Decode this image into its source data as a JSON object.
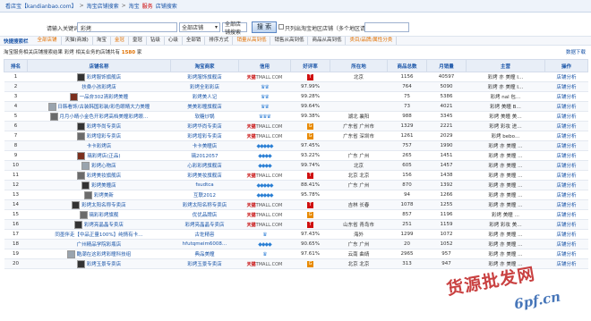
{
  "topbar": {
    "site": "看店宝【kandianbao.com】",
    "crumb1": "淘宝店铺搜索",
    "crumb2_a": "淘宝",
    "crumb2_b": "服务",
    "crumb2_c": "店铺搜索"
  },
  "search": {
    "label": "请输入关键词",
    "keyword": "彩烤",
    "select1": "全部店铺",
    "select2": "全部店铺搜索",
    "button": "搜 索",
    "checkbox_label": "只列出淘宝地区店铺（多个地区请用,区分）"
  },
  "filters": {
    "title": "快捷搜索栏",
    "items": [
      "全部店铺",
      "天猫(商城)",
      "淘宝",
      "金冠",
      "皇冠",
      "钻级",
      "心级",
      "全部销",
      "排序方式",
      "销量从高到低",
      "销售从高到低",
      "商品从高到低",
      "类目/品牌/属性分类"
    ]
  },
  "info": {
    "prefix": "淘宝服务相关店铺搜索结果 彩烤 相关业务的店铺共有",
    "count": "1580",
    "suffix": "家",
    "right": "数据下载"
  },
  "columns": [
    "排名",
    "店铺名称",
    "淘宝商家",
    "信用",
    "好评率",
    "所在地",
    "商品总数",
    "月销量",
    "主营",
    "操作"
  ],
  "rows": [
    {
      "rank": "1",
      "thumb": "t3",
      "shop": "彩烤服饰旗舰店",
      "seller": "彩烤服饰旗舰店",
      "credit": "tmall",
      "rate": "T",
      "loc": "北京",
      "goods": "1156",
      "sales": "40597",
      "main": "彩烤 亦 美瞳 I…",
      "act": "店铺分析"
    },
    {
      "rank": "2",
      "thumb": "",
      "shop": "扶桑小孩彩烤店",
      "seller": "彩烤全彩彩店",
      "credit": "crown2",
      "rate": "97.99%",
      "loc": "",
      "goods": "764",
      "sales": "5090",
      "main": "彩烤 亦 美瞳 I…",
      "act": "店铺分析"
    },
    {
      "rank": "3",
      "thumb": "t0",
      "shop": "一品夯302清彩烤美瞳",
      "seller": "彩烤美人记",
      "credit": "crown2",
      "rate": "99.28%",
      "loc": "",
      "goods": "75",
      "sales": "5386",
      "main": "彩烤 nal 包…",
      "act": "店铺分析"
    },
    {
      "rank": "4",
      "thumb": "t1",
      "shop": "日韩看饰/古装韩国彩装/彩色眼睛大力美瞳",
      "seller": "美美彩瞳旗舰店",
      "credit": "crown2",
      "rate": "99.64%",
      "loc": "",
      "goods": "73",
      "sales": "4021",
      "main": "彩烤 美瞳 B…",
      "act": "店铺分析"
    },
    {
      "rank": "5",
      "thumb": "t2",
      "shop": "月月小睛小金色开彩烤高档美瞳彩烤眼…",
      "seller": "软糖炒锅",
      "credit": "crown3",
      "rate": "99.38%",
      "loc": "湖北 襄阳",
      "goods": "988",
      "sales": "3345",
      "main": "彩烤 美瞳 美…",
      "act": "店铺分析"
    },
    {
      "rank": "6",
      "thumb": "t3",
      "shop": "彩烤华尚专卖店",
      "seller": "彩烤华尚专卖店",
      "credit": "tmall",
      "rate": "G",
      "loc": "广东省 广州市",
      "goods": "1329",
      "sales": "2221",
      "main": "彩烤 彩妆 进…",
      "act": "店铺分析"
    },
    {
      "rank": "7",
      "thumb": "t2",
      "shop": "彩烤增彩专卖店",
      "seller": "彩烤增彩专卖店",
      "credit": "tmall",
      "rate": "G",
      "loc": "广东省 深圳市",
      "goods": "1261",
      "sales": "2029",
      "main": "彩烤 bebo…",
      "act": "店铺分析"
    },
    {
      "rank": "8",
      "thumb": "",
      "shop": "卡卡彩烤店",
      "seller": "卡卡美瞳店",
      "credit": "diamond5",
      "rate": "97.45%",
      "loc": "",
      "goods": "757",
      "sales": "1990",
      "main": "彩烤 亦 美瞳 …",
      "act": "店铺分析"
    },
    {
      "rank": "9",
      "thumb": "t0",
      "shop": "璃彩烤店(正品)",
      "seller": "璃2012057",
      "credit": "diamond4",
      "rate": "93.22%",
      "loc": "广东 广州",
      "goods": "265",
      "sales": "1451",
      "main": "彩烤 亦 美瞳 …",
      "act": "店铺分析"
    },
    {
      "rank": "10",
      "thumb": "t1",
      "shop": "彩烤心物店",
      "seller": "心彩彩烤旗舰店",
      "credit": "diamond4",
      "rate": "99.74%",
      "loc": "北京",
      "goods": "605",
      "sales": "1457",
      "main": "彩烤 亦 美瞳 …",
      "act": "店铺分析"
    },
    {
      "rank": "11",
      "thumb": "t2",
      "shop": "彩烤美妆旗舰店",
      "seller": "彩烤美妆旗舰店",
      "credit": "tmall",
      "rate": "T",
      "loc": "北京 北京",
      "goods": "156",
      "sales": "1438",
      "main": "彩烤 亦 美瞳 …",
      "act": "店铺分析"
    },
    {
      "rank": "12",
      "thumb": "t3",
      "shop": "彩烤美瞳店",
      "seller": "fsudtca",
      "credit": "diamond5",
      "rate": "88.41%",
      "loc": "广东 广州",
      "goods": "870",
      "sales": "1392",
      "main": "彩烤 亦 美瞳 …",
      "act": "店铺分析"
    },
    {
      "rank": "13",
      "thumb": "t2",
      "shop": "彩烤美新",
      "seller": "互联2012",
      "credit": "diamond5",
      "rate": "95.78%",
      "loc": "",
      "goods": "94",
      "sales": "1266",
      "main": "彩烤 亦 美瞳 …",
      "act": "店铺分析"
    },
    {
      "rank": "14",
      "thumb": "t3",
      "shop": "彩烤太阳名称专卖店",
      "seller": "彩烤太阳名称专卖店",
      "credit": "tmall",
      "rate": "T",
      "loc": "吉林 长春",
      "goods": "1078",
      "sales": "1255",
      "main": "彩烤 亦 美瞳 …",
      "act": "店铺分析"
    },
    {
      "rank": "15",
      "thumb": "t2",
      "shop": "璃彩彩烤旗舰",
      "seller": "优优品牌店",
      "credit": "tmall",
      "rate": "G",
      "loc": "",
      "goods": "857",
      "sales": "1196",
      "main": "彩烤 美瞳 …",
      "act": "店铺分析"
    },
    {
      "rank": "16",
      "thumb": "t3",
      "shop": "彩烤亮晶晶专卖店",
      "seller": "彩烤亮晶晶专卖店",
      "credit": "tmall",
      "rate": "T",
      "loc": "山东省 青岛市",
      "goods": "251",
      "sales": "1159",
      "main": "彩烤 彩妆 美…",
      "act": "店铺分析"
    },
    {
      "rank": "17",
      "thumb": "",
      "shop": "同墨伴走【中品正量100%】纯情有卡…",
      "seller": "古佐精容",
      "credit": "crown1",
      "rate": "97.43%",
      "loc": "海外",
      "goods": "1299",
      "sales": "1072",
      "main": "彩烤 亦 美瞳 …",
      "act": "店铺分析"
    },
    {
      "rank": "18",
      "thumb": "",
      "shop": "广州精品学院彩瓶店",
      "seller": "hfutqmeim6008…",
      "credit": "diamond4",
      "rate": "90.65%",
      "loc": "广东 广州",
      "goods": "20",
      "sales": "1052",
      "main": "彩烤 亦 美瞳 …",
      "act": "店铺分析"
    },
    {
      "rank": "19",
      "thumb": "t1",
      "shop": "酷潮在这彩烤彩瞳科技组",
      "seller": "典品美瞳",
      "credit": "crown1",
      "rate": "97.61%",
      "loc": "云南 曲靖",
      "goods": "2965",
      "sales": "957",
      "main": "彩烤 亦 美瞳 …",
      "act": "店铺分析"
    },
    {
      "rank": "20",
      "thumb": "t3",
      "shop": "彩烤玉景专卖店",
      "seller": "彩烤玉景专卖店",
      "credit": "tmall",
      "rate": "G",
      "loc": "北京 北京",
      "goods": "313",
      "sales": "947",
      "main": "彩烤 亦 美瞳 …",
      "act": "店铺分析"
    }
  ],
  "watermark": {
    "line1": "货源批发网",
    "line2": "6pf.cn"
  }
}
